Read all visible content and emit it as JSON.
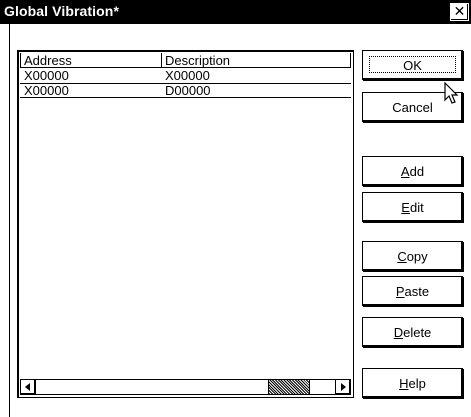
{
  "window": {
    "title": "Global Vibration*",
    "close_label": "✕"
  },
  "list": {
    "columns": [
      "Address",
      "Description"
    ],
    "rows": [
      {
        "address": "X00000",
        "description": "X00000"
      },
      {
        "address": "X00000",
        "description": "D00000"
      }
    ]
  },
  "buttons": {
    "ok": {
      "label": "OK"
    },
    "cancel": {
      "label": "Cancel"
    },
    "add": {
      "mnemonic": "A",
      "rest": "dd"
    },
    "edit": {
      "mnemonic": "E",
      "rest": "dit"
    },
    "copy": {
      "mnemonic": "C",
      "rest": "opy"
    },
    "paste": {
      "mnemonic": "P",
      "rest": "aste"
    },
    "delete": {
      "mnemonic": "D",
      "rest": "elete"
    },
    "help": {
      "mnemonic": "H",
      "rest": "elp"
    }
  },
  "icons": {
    "close": "close-icon",
    "cursor": "mouse-pointer-icon",
    "scroll_left": "arrow-left-icon",
    "scroll_right": "arrow-right-icon"
  }
}
